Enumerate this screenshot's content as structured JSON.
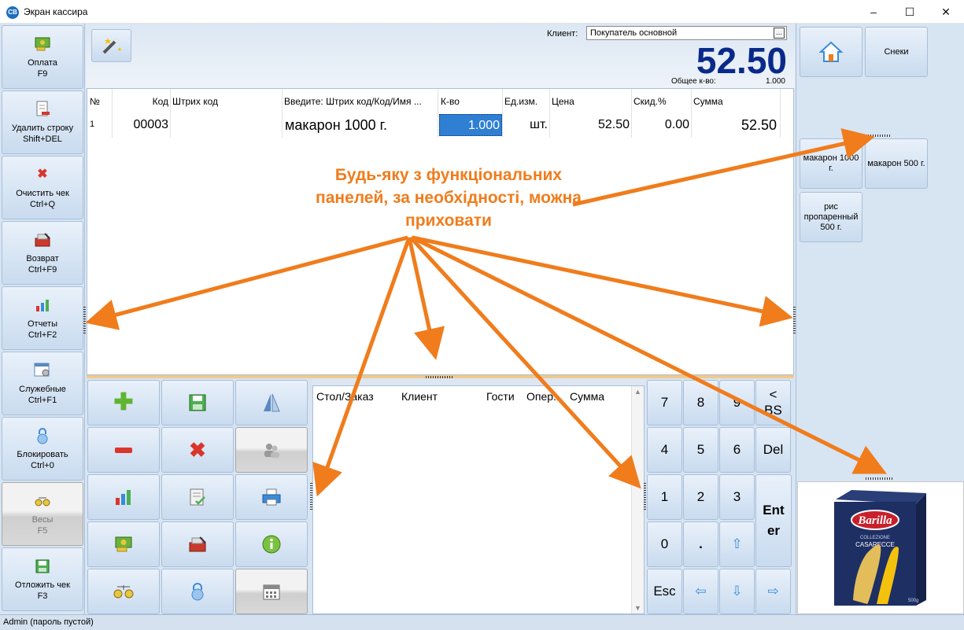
{
  "window": {
    "title": "Экран кассира",
    "app_icon": "СВ",
    "minimize": "–",
    "maximize": "☐",
    "close": "✕"
  },
  "sidebar": {
    "items": [
      {
        "label": "Оплата",
        "shortcut": "F9",
        "icon": "money-icon"
      },
      {
        "label": "Удалить строку",
        "shortcut": "Shift+DEL",
        "icon": "delete-row-icon"
      },
      {
        "label": "Очистить чек",
        "shortcut": "Ctrl+Q",
        "icon": "clear-icon"
      },
      {
        "label": "Возврат",
        "shortcut": "Ctrl+F9",
        "icon": "return-icon"
      },
      {
        "label": "Отчеты",
        "shortcut": "Ctrl+F2",
        "icon": "chart-icon"
      },
      {
        "label": "Служебные",
        "shortcut": "Ctrl+F1",
        "icon": "settings-icon"
      },
      {
        "label": "Блокировать",
        "shortcut": "Ctrl+0",
        "icon": "lock-icon"
      },
      {
        "label": "Весы",
        "shortcut": "F5",
        "icon": "scales-icon"
      },
      {
        "label": "Отложить чек",
        "shortcut": "F3",
        "icon": "save-icon"
      }
    ]
  },
  "header": {
    "client_label": "Клиент:",
    "client_value": "Покупатель основной",
    "client_dots": "...",
    "total": "52.50",
    "qty_label": "Общее к-во:",
    "qty_value": "1.000"
  },
  "grid": {
    "columns": [
      "№",
      "Код",
      "Штрих код",
      "Введите: Штрих код/Код/Имя ...",
      "К-во",
      "Ед.изм.",
      "Цена",
      "Скид.%",
      "Сумма"
    ],
    "rows": [
      {
        "num": "1",
        "code": "00003",
        "barcode": "",
        "name": "макарон 1000 г.",
        "qty": "1.000",
        "unit": "шт.",
        "price": "52.50",
        "discount": "0.00",
        "sum": "52.50"
      }
    ]
  },
  "orders": {
    "columns": [
      "Стол/Заказ",
      "Клиент",
      "Гости",
      "Опер...",
      "Сумма"
    ]
  },
  "keypad": {
    "keys": [
      "7",
      "8",
      "9",
      "<\nBS",
      "4",
      "5",
      "6",
      "Del",
      "1",
      "2",
      "3",
      "Enter",
      "0",
      ".",
      "⇧",
      "Esc",
      "⇦",
      "⇩",
      "⇨"
    ]
  },
  "right_panel": {
    "top_buttons": [
      {
        "label": "",
        "icon": "home-icon"
      },
      {
        "label": "Снеки"
      }
    ],
    "products": [
      "макарон 1000 г.",
      "макарон 500 г.",
      "рис пропаренный 500 г."
    ]
  },
  "image": {
    "brand": "Barilla",
    "line1": "COLLEZIONE",
    "line2": "CASARECCE",
    "weight": "500g"
  },
  "status": {
    "text": "Admin (пароль пустой)"
  },
  "annotation": {
    "text": "Будь-яку з функціональних панелей, за необхідності, можна приховати"
  },
  "colors": {
    "accent": "#f07c1c",
    "total": "#0a2a8a",
    "selection": "#2f7fd3"
  }
}
